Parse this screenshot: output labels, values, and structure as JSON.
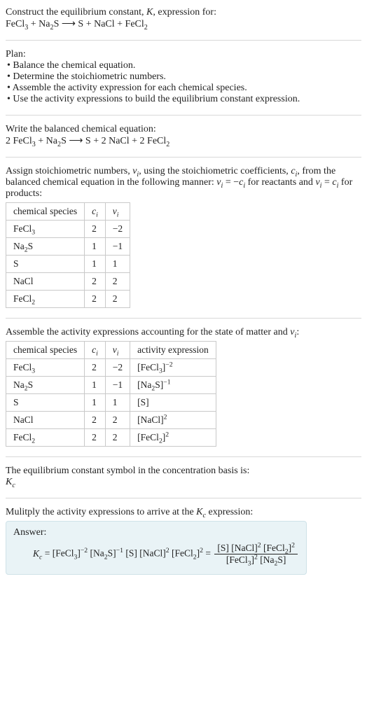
{
  "header": {
    "line1": "Construct the equilibrium constant, K, expression for:",
    "eq_lhs": "FeCl",
    "eq": "FeCl₃ + Na₂S ⟶ S + NaCl + FeCl₂"
  },
  "plan": {
    "title": "Plan:",
    "b1": "• Balance the chemical equation.",
    "b2": "• Determine the stoichiometric numbers.",
    "b3": "• Assemble the activity expression for each chemical species.",
    "b4": "• Use the activity expressions to build the equilibrium constant expression."
  },
  "balanced": {
    "title": "Write the balanced chemical equation:",
    "eq": "2 FeCl₃ + Na₂S ⟶ S + 2 NaCl + 2 FeCl₂"
  },
  "assign": {
    "text1": "Assign stoichiometric numbers, νᵢ, using the stoichiometric coefficients, cᵢ, from the balanced chemical equation in the following manner: νᵢ = −cᵢ for reactants and νᵢ = cᵢ for products:",
    "headers": {
      "h1": "chemical species",
      "h2": "cᵢ",
      "h3": "νᵢ"
    },
    "rows": [
      {
        "sp": "FeCl₃",
        "c": "2",
        "v": "−2"
      },
      {
        "sp": "Na₂S",
        "c": "1",
        "v": "−1"
      },
      {
        "sp": "S",
        "c": "1",
        "v": "1"
      },
      {
        "sp": "NaCl",
        "c": "2",
        "v": "2"
      },
      {
        "sp": "FeCl₂",
        "c": "2",
        "v": "2"
      }
    ]
  },
  "activity": {
    "title": "Assemble the activity expressions accounting for the state of matter and νᵢ:",
    "headers": {
      "h1": "chemical species",
      "h2": "cᵢ",
      "h3": "νᵢ",
      "h4": "activity expression"
    },
    "rows": [
      {
        "sp": "FeCl₃",
        "c": "2",
        "v": "−2",
        "a": "[FeCl₃]⁻²"
      },
      {
        "sp": "Na₂S",
        "c": "1",
        "v": "−1",
        "a": "[Na₂S]⁻¹"
      },
      {
        "sp": "S",
        "c": "1",
        "v": "1",
        "a": "[S]"
      },
      {
        "sp": "NaCl",
        "c": "2",
        "v": "2",
        "a": "[NaCl]²"
      },
      {
        "sp": "FeCl₂",
        "c": "2",
        "v": "2",
        "a": "[FeCl₂]²"
      }
    ]
  },
  "symbol": {
    "line": "The equilibrium constant symbol in the concentration basis is:",
    "kc": "K_c"
  },
  "multiply": {
    "line": "Mulitply the activity expressions to arrive at the K_c expression:"
  },
  "answer": {
    "label": "Answer:",
    "lhs": "K_c = [FeCl₃]⁻² [Na₂S]⁻¹ [S] [NaCl]² [FeCl₂]² = ",
    "num": "[S] [NaCl]² [FeCl₂]²",
    "den": "[FeCl₃]² [Na₂S]"
  },
  "chart_data": {
    "type": "table",
    "tables": [
      {
        "title": "Stoichiometric numbers",
        "columns": [
          "chemical species",
          "c_i",
          "ν_i"
        ],
        "rows": [
          [
            "FeCl3",
            2,
            -2
          ],
          [
            "Na2S",
            1,
            -1
          ],
          [
            "S",
            1,
            1
          ],
          [
            "NaCl",
            2,
            2
          ],
          [
            "FeCl2",
            2,
            2
          ]
        ]
      },
      {
        "title": "Activity expressions",
        "columns": [
          "chemical species",
          "c_i",
          "ν_i",
          "activity expression"
        ],
        "rows": [
          [
            "FeCl3",
            2,
            -2,
            "[FeCl3]^-2"
          ],
          [
            "Na2S",
            1,
            -1,
            "[Na2S]^-1"
          ],
          [
            "S",
            1,
            1,
            "[S]"
          ],
          [
            "NaCl",
            2,
            2,
            "[NaCl]^2"
          ],
          [
            "FeCl2",
            2,
            2,
            "[FeCl2]^2"
          ]
        ]
      }
    ]
  }
}
